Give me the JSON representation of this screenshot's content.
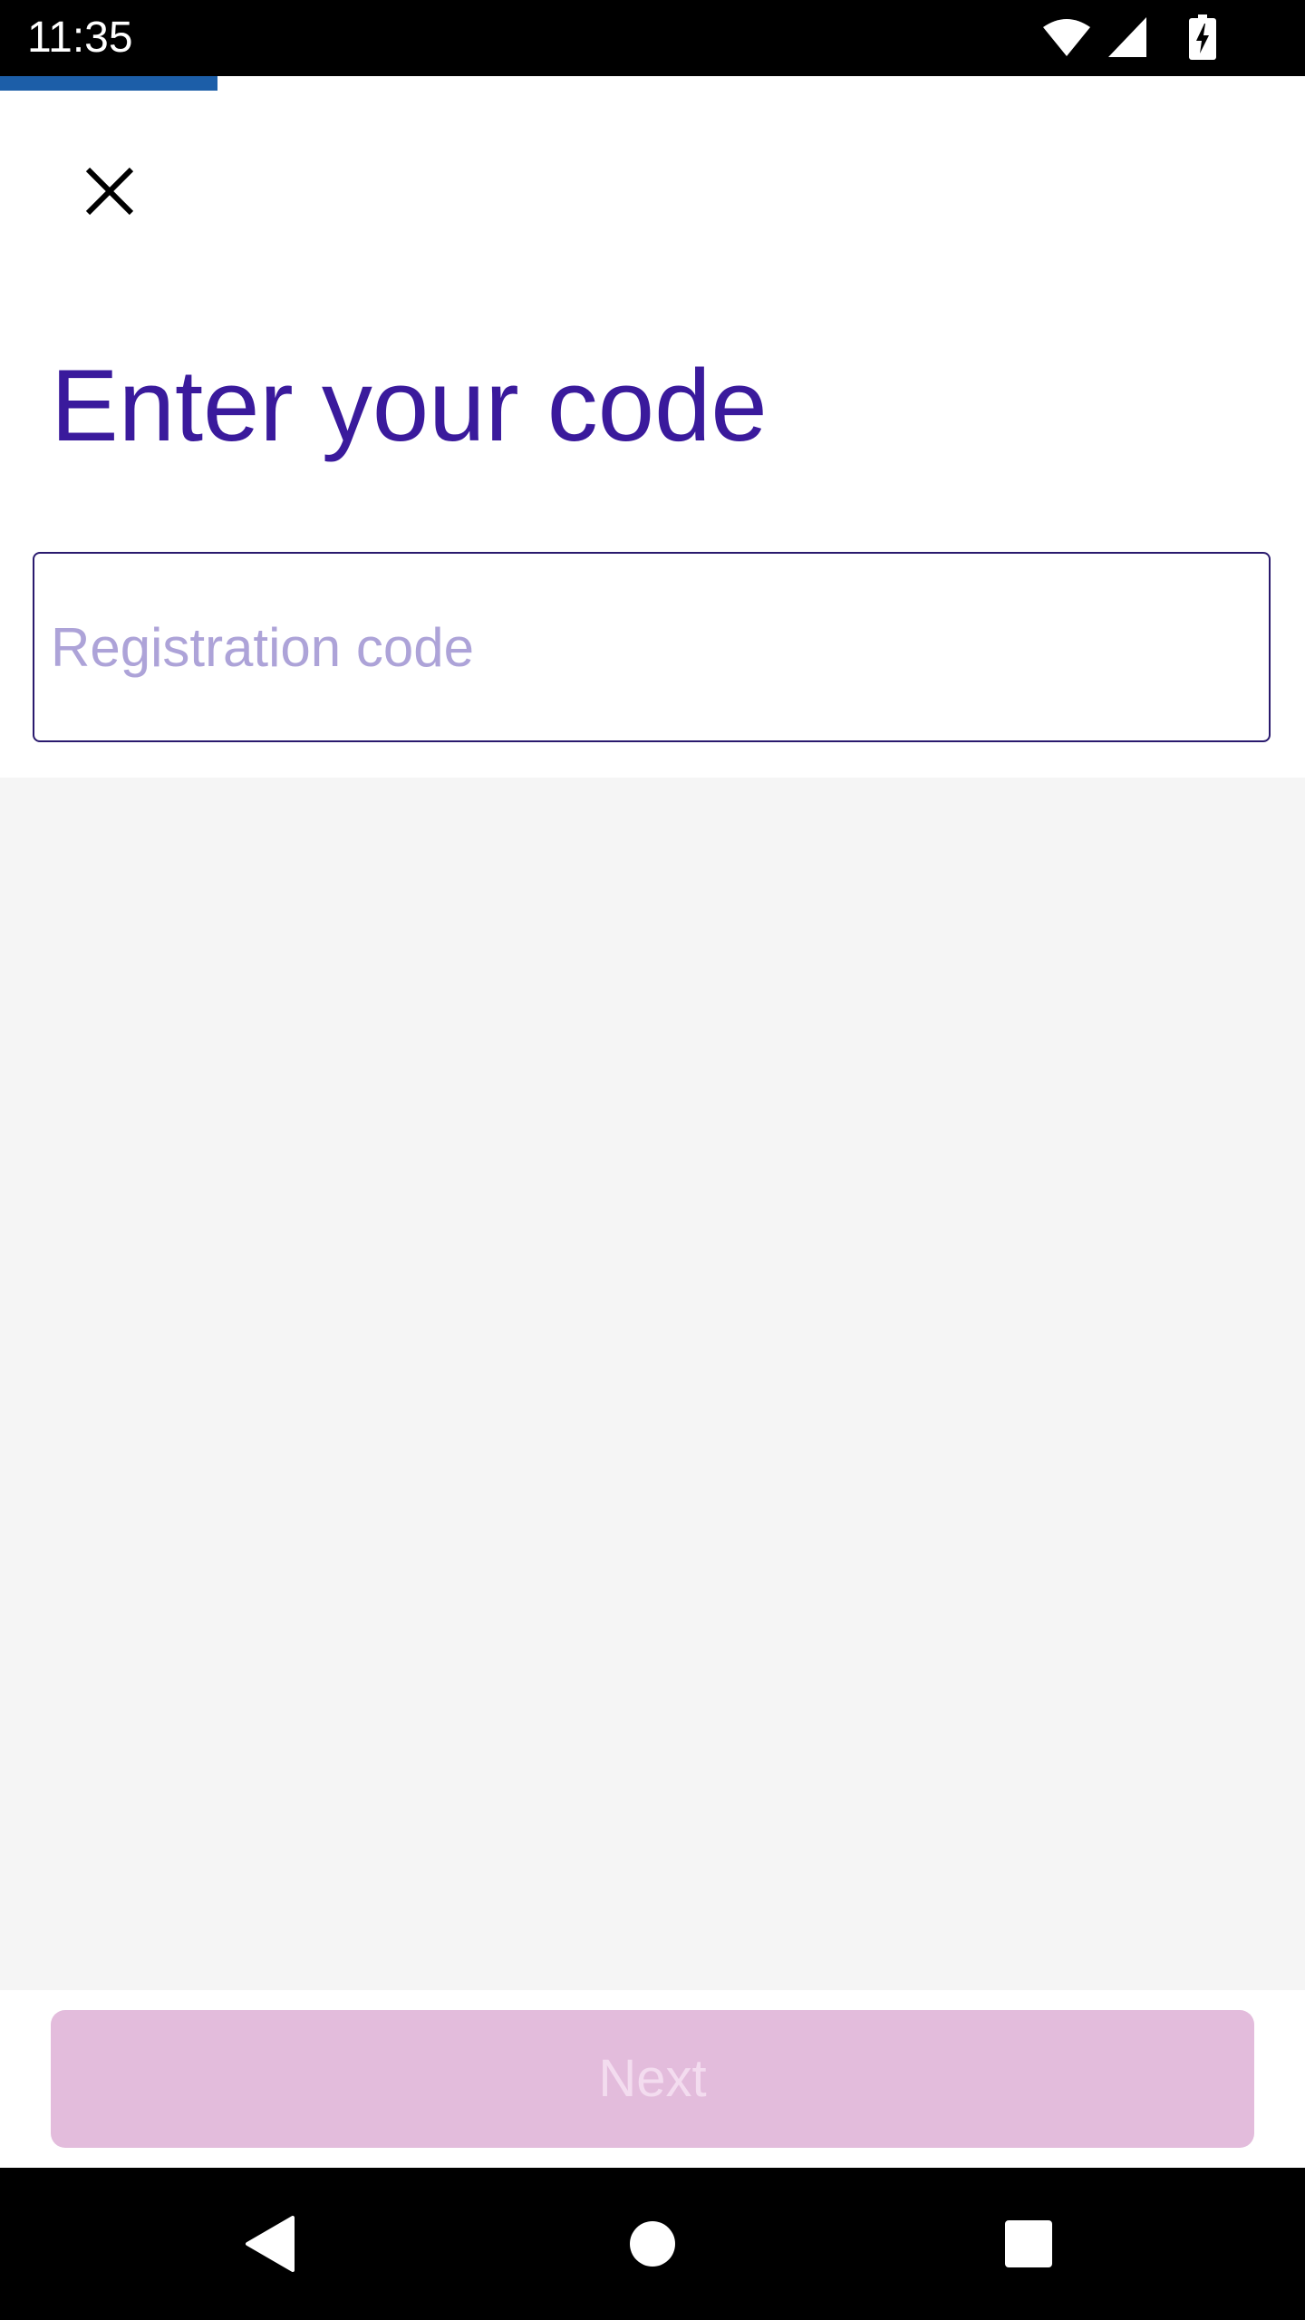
{
  "status_bar": {
    "time": "11:35",
    "icons": [
      "wifi-icon",
      "cell-signal-icon",
      "battery-charging-icon"
    ]
  },
  "progress": {
    "fraction": 0.167,
    "color": "#1c5ea8"
  },
  "header": {
    "close_icon": "close-icon"
  },
  "main": {
    "title": "Enter your code",
    "code_field": {
      "value": "",
      "placeholder": "Registration code"
    }
  },
  "footer": {
    "next_label": "Next"
  },
  "nav_bar": {
    "icons": [
      "back-icon",
      "home-icon",
      "recents-icon"
    ]
  },
  "colors": {
    "title": "#3a1a9c",
    "placeholder": "#ada3d8",
    "button_disabled_bg": "#e3bcdc",
    "button_disabled_text": "#f3dcef",
    "content_bg": "#f5f5f5"
  }
}
